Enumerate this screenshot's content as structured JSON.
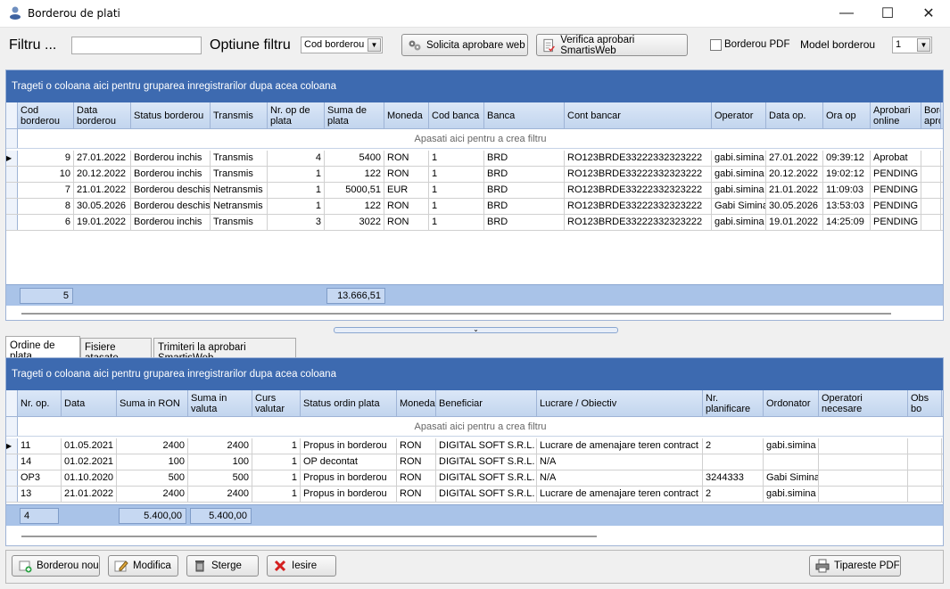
{
  "window": {
    "title": "Borderou de plati",
    "minimize": "—",
    "maximize": "☐",
    "close": "✕"
  },
  "toolbar": {
    "filter_label": "Filtru ...",
    "filter_value": "",
    "option_label": "Optiune filtru",
    "option_value": "Cod borderou",
    "solicita_label": "Solicita aprobare web",
    "verifica_label": "Verifica aprobari SmartisWeb",
    "pdf_label": "Borderou PDF",
    "model_label": "Model  borderou",
    "model_value": "1"
  },
  "top_grid": {
    "group_hint": "Trageti o coloana aici pentru gruparea inregistrarilor dupa acea coloana",
    "filter_hint": "Apasati aici pentru a  crea filtru",
    "columns": [
      "Cod borderou",
      "Data borderou",
      "Status borderou",
      "Transmis",
      "Nr. op de plata",
      "Suma de plata",
      "Moneda",
      "Cod banca",
      "Banca",
      "Cont bancar",
      "Operator",
      "Data op.",
      "Ora op",
      "Aprobari online",
      "Bord apro"
    ],
    "rows": [
      [
        "9",
        "27.01.2022",
        "Borderou inchis",
        "Transmis",
        "4",
        "5400",
        "RON",
        "1",
        "BRD",
        "RO123BRDE33222332323222",
        "gabi.simina",
        "27.01.2022",
        "09:39:12",
        "Aprobat",
        ""
      ],
      [
        "10",
        "20.12.2022",
        "Borderou inchis",
        "Transmis",
        "1",
        "122",
        "RON",
        "1",
        "BRD",
        "RO123BRDE33222332323222",
        "gabi.simina",
        "20.12.2022",
        "19:02:12",
        "PENDING",
        ""
      ],
      [
        "7",
        "21.01.2022",
        "Borderou deschis",
        "Netransmis",
        "1",
        "5000,51",
        "EUR",
        "1",
        "BRD",
        "RO123BRDE33222332323222",
        "gabi.simina",
        "21.01.2022",
        "11:09:03",
        "PENDING",
        ""
      ],
      [
        "8",
        "30.05.2026",
        "Borderou deschis",
        "Netransmis",
        "1",
        "122",
        "RON",
        "1",
        "BRD",
        "RO123BRDE33222332323222",
        "Gabi Simina",
        "30.05.2026",
        "13:53:03",
        "PENDING",
        ""
      ],
      [
        "6",
        "19.01.2022",
        "Borderou inchis",
        "Transmis",
        "3",
        "3022",
        "RON",
        "1",
        "BRD",
        "RO123BRDE33222332323222",
        "gabi.simina",
        "19.01.2022",
        "14:25:09",
        "PENDING",
        ""
      ]
    ],
    "footer_count": "5",
    "footer_sum": "13.666,51"
  },
  "tabs": [
    "Ordine de plata",
    "Fisiere atasate",
    "Trimiteri la aprobari SmartisWeb"
  ],
  "bottom_grid": {
    "group_hint": "Trageti o coloana aici pentru gruparea inregistrarilor dupa acea coloana",
    "filter_hint": "Apasati aici pentru a  crea filtru",
    "columns": [
      "Nr. op.",
      "Data",
      "Suma in RON",
      "Suma in valuta",
      "Curs valutar",
      "Status ordin plata",
      "Moneda",
      "Beneficiar",
      "Lucrare / Obiectiv",
      "Nr. planificare",
      "Ordonator",
      "Operatori necesare",
      "Obs bo"
    ],
    "rows": [
      [
        "11",
        "01.05.2021",
        "2400",
        "2400",
        "1",
        "Propus in borderou",
        "RON",
        "DIGITAL SOFT S.R.L.",
        "Lucrare de amenajare teren contract",
        "2",
        "gabi.simina",
        "",
        ""
      ],
      [
        "14",
        "01.02.2021",
        "100",
        "100",
        "1",
        "OP decontat",
        "RON",
        "DIGITAL SOFT S.R.L.",
        "N/A",
        "",
        "",
        "",
        ""
      ],
      [
        "OP3",
        "01.10.2020",
        "500",
        "500",
        "1",
        "Propus in borderou",
        "RON",
        "DIGITAL SOFT S.R.L.",
        "N/A",
        "3244333",
        "Gabi Simina",
        "",
        ""
      ],
      [
        "13",
        "21.01.2022",
        "2400",
        "2400",
        "1",
        "Propus in borderou",
        "RON",
        "DIGITAL SOFT S.R.L.",
        "Lucrare de amenajare teren contract",
        "2",
        "gabi.simina",
        "",
        ""
      ]
    ],
    "footer_count": "4",
    "footer_sum_ron": "5.400,00",
    "footer_sum_valuta": "5.400,00"
  },
  "bottom_buttons": {
    "nou": "Borderou nou",
    "modifica": "Modifica",
    "sterge": "Sterge",
    "iesire": "Iesire",
    "tipareste": "Tipareste PDF"
  }
}
